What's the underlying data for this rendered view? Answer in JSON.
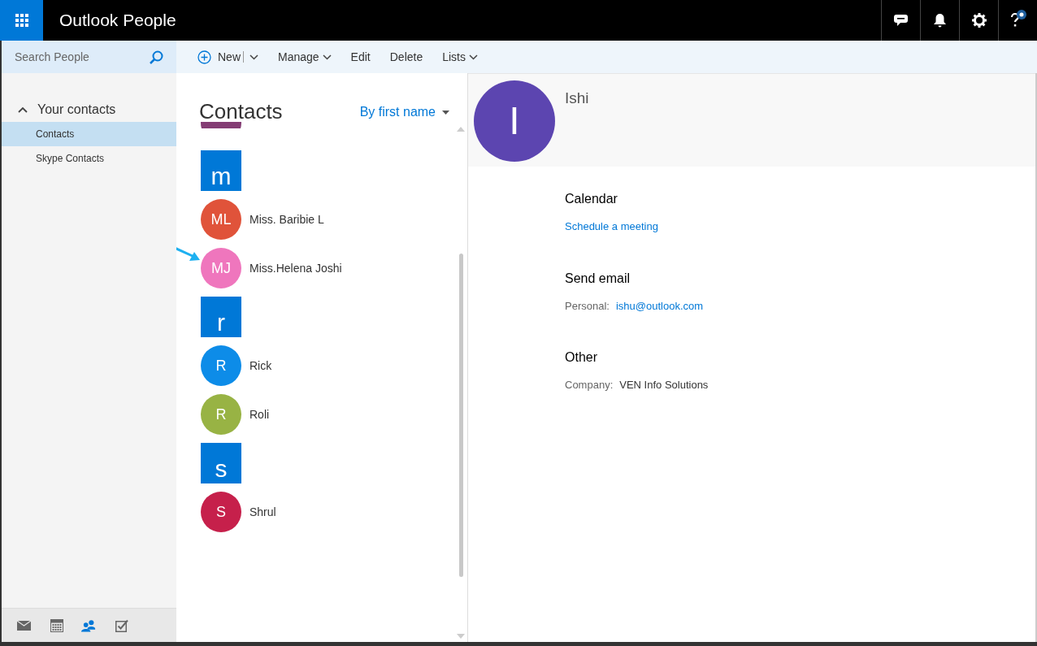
{
  "app_title": "Outlook People",
  "search": {
    "placeholder": "Search People"
  },
  "toolbar": [
    {
      "label": "New",
      "kind": "new"
    },
    {
      "label": "Manage",
      "kind": "menu"
    },
    {
      "label": "Edit",
      "kind": "plain"
    },
    {
      "label": "Delete",
      "kind": "plain"
    },
    {
      "label": "Lists",
      "kind": "menu"
    }
  ],
  "nav": {
    "group": "Your contacts",
    "expanded": true,
    "items": [
      {
        "label": "Contacts",
        "selected": true
      },
      {
        "label": "Skype Contacts",
        "selected": false
      }
    ]
  },
  "bottom_nav": [
    {
      "kind": "mail",
      "selected": false
    },
    {
      "kind": "calendar",
      "selected": false
    },
    {
      "kind": "people",
      "selected": true
    },
    {
      "kind": "tasks",
      "selected": false
    }
  ],
  "list": {
    "title": "Contacts",
    "sort": "By first name",
    "items": [
      {
        "kind": "partial",
        "color": "#843d74"
      },
      {
        "kind": "letter",
        "label": "m"
      },
      {
        "kind": "contact",
        "initials": "ML",
        "name": "Miss. Baribie L",
        "color": "#e0533a"
      },
      {
        "kind": "contact",
        "initials": "MJ",
        "name": "Miss.Helena Joshi",
        "color": "#ef76bd",
        "pointed": true
      },
      {
        "kind": "letter",
        "label": "r"
      },
      {
        "kind": "contact",
        "initials": "R",
        "name": "Rick",
        "color": "#0d8ce8"
      },
      {
        "kind": "contact",
        "initials": "R",
        "name": "Roli",
        "color": "#98b344"
      },
      {
        "kind": "letter",
        "label": "s"
      },
      {
        "kind": "contact",
        "initials": "S",
        "name": "Shrul",
        "color": "#c6204b"
      }
    ]
  },
  "detail": {
    "initial": "I",
    "name": "Ishi",
    "sections": [
      {
        "title": "Calendar",
        "kind": "link",
        "value": "Schedule a meeting"
      },
      {
        "title": "Send email",
        "kind": "field",
        "label": "Personal:",
        "value": "ishu@outlook.com",
        "link": true
      },
      {
        "title": "Other",
        "kind": "field",
        "label": "Company:",
        "value": "VEN Info Solutions",
        "link": false
      }
    ]
  }
}
